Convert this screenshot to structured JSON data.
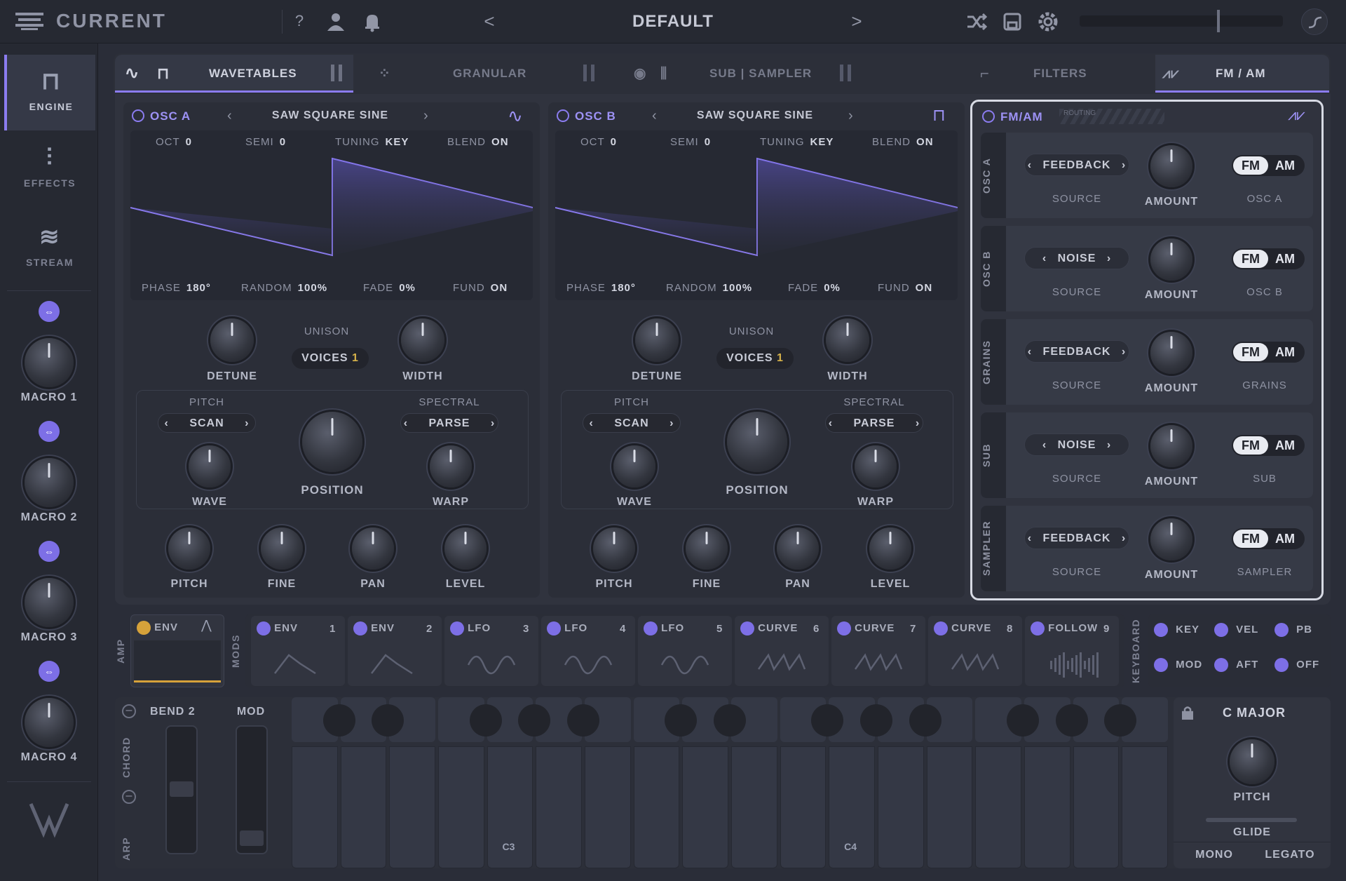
{
  "app": {
    "name": "CURRENT",
    "preset": "DEFAULT"
  },
  "topbar": {
    "help_icon": "question-icon",
    "user_icon": "user-icon",
    "bell_icon": "bell-icon",
    "prev_icon": "chevron-left-icon",
    "next_icon": "chevron-right-icon",
    "prev": "<",
    "next": ">",
    "help": "?"
  },
  "sidebar": {
    "nav": [
      {
        "label": "ENGINE",
        "icon": "engine-icon"
      },
      {
        "label": "EFFECTS",
        "icon": "sliders-icon"
      },
      {
        "label": "STREAM",
        "icon": "stream-icon"
      }
    ],
    "macros": [
      "MACRO 1",
      "MACRO 2",
      "MACRO 3",
      "MACRO 4"
    ]
  },
  "tabs": {
    "wavetables": "WAVETABLES",
    "granular": "GRANULAR",
    "sub_sampler": "SUB | SAMPLER",
    "filters": "FILTERS",
    "fm_am": "FM / AM"
  },
  "osc_a": {
    "name": "OSC A",
    "wavetable": "SAW SQUARE SINE",
    "oct_label": "OCT",
    "oct": "0",
    "semi_label": "SEMI",
    "semi": "0",
    "tuning_label": "TUNING",
    "tuning": "KEY",
    "blend_label": "BLEND",
    "blend": "ON",
    "phase_label": "PHASE",
    "phase": "180°",
    "random_label": "RANDOM",
    "random": "100%",
    "fade_label": "FADE",
    "fade": "0%",
    "fund_label": "FUND",
    "fund": "ON",
    "unison": "UNISON",
    "voices_label": "VOICES",
    "voices": "1",
    "detune": "DETUNE",
    "width": "WIDTH",
    "pitch_mode_label": "PITCH",
    "pitch_mode": "SCAN",
    "spectral_label": "SPECTRAL",
    "spectral": "PARSE",
    "wave": "WAVE",
    "position": "POSITION",
    "warp": "WARP",
    "pitch": "PITCH",
    "fine": "FINE",
    "pan": "PAN",
    "level": "LEVEL"
  },
  "osc_b": {
    "name": "OSC B",
    "wavetable": "SAW SQUARE SINE",
    "oct_label": "OCT",
    "oct": "0",
    "semi_label": "SEMI",
    "semi": "0",
    "tuning_label": "TUNING",
    "tuning": "KEY",
    "blend_label": "BLEND",
    "blend": "ON",
    "phase_label": "PHASE",
    "phase": "180°",
    "random_label": "RANDOM",
    "random": "100%",
    "fade_label": "FADE",
    "fade": "0%",
    "fund_label": "FUND",
    "fund": "ON",
    "unison": "UNISON",
    "voices_label": "VOICES",
    "voices": "1",
    "detune": "DETUNE",
    "width": "WIDTH",
    "pitch_mode_label": "PITCH",
    "pitch_mode": "SCAN",
    "spectral_label": "SPECTRAL",
    "spectral": "PARSE",
    "wave": "WAVE",
    "position": "POSITION",
    "warp": "WARP",
    "pitch": "PITCH",
    "fine": "FINE",
    "pan": "PAN",
    "level": "LEVEL"
  },
  "fm": {
    "title": "FM/AM",
    "routing": "ROUTING",
    "rows": [
      {
        "side": "OSC A",
        "source": "FEEDBACK",
        "target": "OSC A"
      },
      {
        "side": "OSC B",
        "source": "NOISE",
        "target": "OSC B"
      },
      {
        "side": "GRAINS",
        "source": "FEEDBACK",
        "target": "GRAINS"
      },
      {
        "side": "SUB",
        "source": "NOISE",
        "target": "SUB"
      },
      {
        "side": "SAMPLER",
        "source": "FEEDBACK",
        "target": "SAMPLER"
      }
    ],
    "source_label": "SOURCE",
    "amount_label": "AMOUNT",
    "fm_label": "FM",
    "am_label": "AM"
  },
  "mods": {
    "amp_label": "AMP",
    "mods_label": "MODS",
    "keyboard_label": "KEYBOARD",
    "amp_env": "ENV",
    "slots": [
      {
        "name": "ENV",
        "num": "1"
      },
      {
        "name": "ENV",
        "num": "2"
      },
      {
        "name": "LFO",
        "num": "3"
      },
      {
        "name": "LFO",
        "num": "4"
      },
      {
        "name": "LFO",
        "num": "5"
      },
      {
        "name": "CURVE",
        "num": "6"
      },
      {
        "name": "CURVE",
        "num": "7"
      },
      {
        "name": "CURVE",
        "num": "8"
      },
      {
        "name": "FOLLOW",
        "num": "9"
      }
    ],
    "kb": [
      "KEY",
      "VEL",
      "PB",
      "MOD",
      "AFT",
      "OFF"
    ]
  },
  "keyboard": {
    "chord": "CHORD",
    "arp": "ARP",
    "bend_label": "BEND",
    "bend": "2",
    "mod": "MOD",
    "c3": "C3",
    "c4": "C4",
    "scale": "C MAJOR",
    "pitch": "PITCH",
    "glide": "GLIDE",
    "mono": "MONO",
    "legato": "LEGATO"
  },
  "colors": {
    "accent": "#8b7cf0",
    "bg": "#2a2d38"
  }
}
